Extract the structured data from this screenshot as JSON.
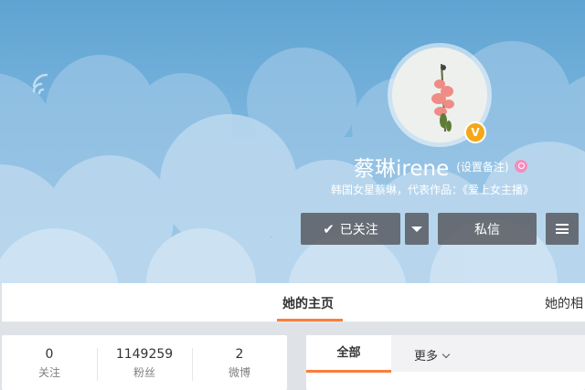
{
  "profile": {
    "name": "蔡琳irene",
    "remark_label": "(设置备注)",
    "intro": "韩国女星蔡琳，代表作品：《爱上女主播》",
    "vip_badge": "V",
    "avatar_icon": "avatar-photo",
    "gender_icon": "female-icon"
  },
  "actions": {
    "follow_label": "已关注",
    "check_glyph": "✔",
    "message_label": "私信"
  },
  "tabs": [
    {
      "label": "她的主页",
      "active": true
    },
    {
      "label": "她的相"
    }
  ],
  "stats": [
    {
      "value": "0",
      "label": "关注"
    },
    {
      "value": "1149259",
      "label": "粉丝"
    },
    {
      "value": "2",
      "label": "微博"
    }
  ],
  "feed_filter": {
    "all_label": "全部",
    "more_label": "更多"
  },
  "colors": {
    "accent": "#fa7d3c",
    "banner_top": "#5fa3d2",
    "vip_gold": "#f4a818",
    "gender_pink": "#f78cbf"
  }
}
